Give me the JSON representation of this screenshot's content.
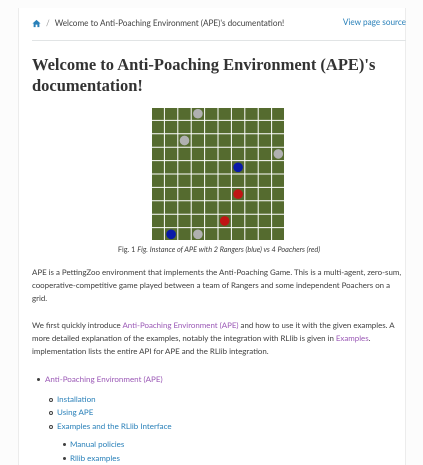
{
  "breadcrumb": {
    "home_icon": "home-icon",
    "separator": "/",
    "current": "Welcome to Anti-Poaching Environment (APE)'s documentation!",
    "view_source": "View page source"
  },
  "title": "Welcome to Anti-Poaching Environment (APE)'s documentation!",
  "figure": {
    "caption_prefix": "Fig. 1",
    "caption_text": "Fig. Instance of APE with 2 Rangers (blue) vs 4 Poachers (red)",
    "grid_size": 10,
    "colors": {
      "background": "#556b2f",
      "grid": "#ffffff",
      "blue": "#0a1aa8",
      "red": "#c01414",
      "gray": "#b0b0b0"
    },
    "agents": [
      {
        "type": "gray",
        "row": 0,
        "col": 3
      },
      {
        "type": "gray",
        "row": 2,
        "col": 2
      },
      {
        "type": "gray",
        "row": 3,
        "col": 9
      },
      {
        "type": "blue",
        "row": 4,
        "col": 6
      },
      {
        "type": "red",
        "row": 6,
        "col": 6
      },
      {
        "type": "red",
        "row": 8,
        "col": 5
      },
      {
        "type": "blue",
        "row": 9,
        "col": 1
      },
      {
        "type": "gray",
        "row": 9,
        "col": 3
      }
    ]
  },
  "para1": "APE is a PettingZoo environment that implements the Anti-Poaching Game. This is a multi-agent, zero-sum, cooperative-competitive game played between a team of Rangers and some independent Poachers on a grid.",
  "para2": {
    "text1": "We first quickly introduce ",
    "link1": "Anti-Poaching Environment (APE)",
    "text2": " and how to use it with the given examples. A more detailed explanation of the examples, notably the integration with RLlib is given in ",
    "link2": "Examples",
    "text3": ". implementation lists the entire API for APE and the RLlib integration."
  },
  "toc": {
    "level1": "Anti-Poaching Environment (APE)",
    "level2": [
      "Installation",
      "Using APE",
      "Examples and the RLlib Interface"
    ],
    "level3": [
      "Manual policies",
      "Rllib examples"
    ]
  }
}
